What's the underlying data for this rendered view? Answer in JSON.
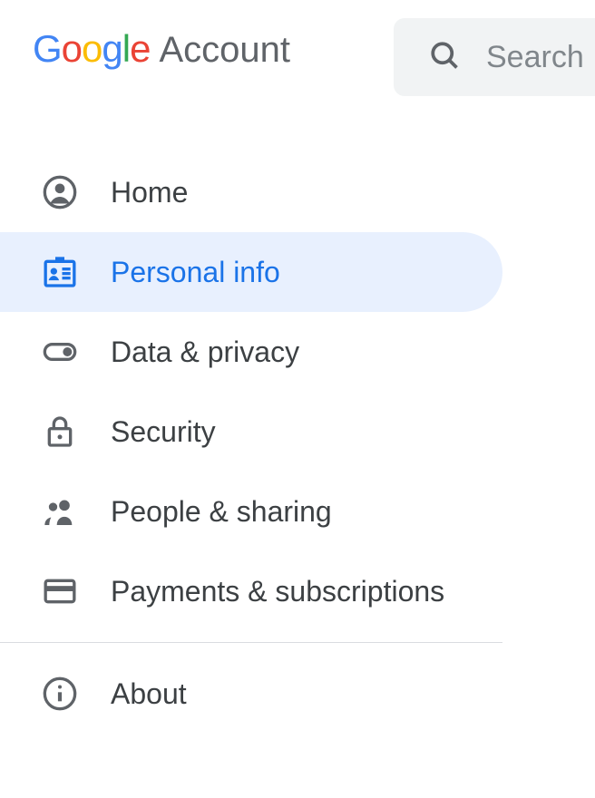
{
  "header": {
    "logo_text": "Google",
    "account_label": "Account"
  },
  "search": {
    "placeholder": "Search"
  },
  "nav": {
    "items": [
      {
        "label": "Home",
        "icon": "account-circle",
        "active": false
      },
      {
        "label": "Personal info",
        "icon": "badge",
        "active": true
      },
      {
        "label": "Data & privacy",
        "icon": "toggle",
        "active": false
      },
      {
        "label": "Security",
        "icon": "lock",
        "active": false
      },
      {
        "label": "People & sharing",
        "icon": "people",
        "active": false
      },
      {
        "label": "Payments & subscriptions",
        "icon": "card",
        "active": false
      }
    ],
    "about_label": "About"
  },
  "colors": {
    "accent": "#1a73e8",
    "active_bg": "#e8f0fe",
    "text": "#3c4043",
    "muted": "#5f6368"
  }
}
